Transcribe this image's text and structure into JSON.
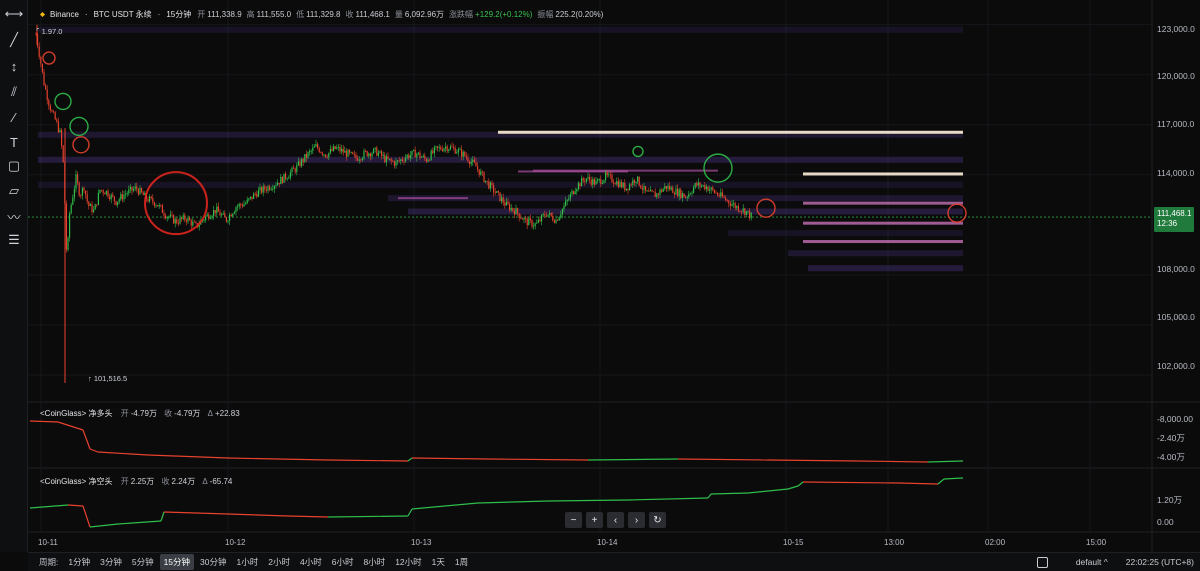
{
  "header": {
    "exchange": "Binance",
    "symbol": "BTC USDT 永续",
    "interval": "15分钟",
    "open_k": "开",
    "open_v": "111,338.9",
    "high_k": "高",
    "high_v": "111,555.0",
    "low_k": "低",
    "low_v": "111,329.8",
    "close_k": "收",
    "close_v": "111,468.1",
    "vol_k": "量",
    "vol_v": "6,092.96万",
    "chg_k": "涨跌幅",
    "chg_v": "+129.2(+0.12%)",
    "amp_k": "振幅",
    "amp_v": "225.2(0.20%)"
  },
  "price_scale": [
    "123,000.0",
    "120,000.0",
    "117,000.0",
    "114,000.0",
    "108,000.0",
    "105,000.0",
    "102,000.0"
  ],
  "price_tag": {
    "price": "111,468.1",
    "countdown": "12:36"
  },
  "high_marker": "1.97.0",
  "low_marker": "101,516.5",
  "indicator1": {
    "name": "<CoinGlass> 净多头",
    "open_k": "开",
    "open_v": "-4.79万",
    "close_k": "收",
    "close_v": "-4.79万",
    "delta_k": "Δ",
    "delta_v": "+22.83",
    "scale": [
      "-8,000.00",
      "-2.40万",
      "-4.00万"
    ]
  },
  "indicator2": {
    "name": "<CoinGlass> 净空头",
    "open_k": "开",
    "open_v": "2.25万",
    "close_k": "收",
    "close_v": "2.24万",
    "delta_k": "Δ",
    "delta_v": "-65.74",
    "scale": [
      "1.20万",
      "0.00"
    ]
  },
  "time_axis": [
    "10-11",
    "10-12",
    "10-13",
    "10-14",
    "10-15",
    "13:00",
    "02:00",
    "15:00"
  ],
  "nav_buttons": [
    "−",
    "+",
    "‹",
    "›",
    "↻"
  ],
  "bottom_bar": {
    "period_label": "周期:",
    "periods": [
      "1分钟",
      "3分钟",
      "5分钟",
      "15分钟",
      "30分钟",
      "1小时",
      "2小时",
      "4小时",
      "6小时",
      "8小时",
      "12小时",
      "1天",
      "1周"
    ],
    "active_period": "15分钟",
    "layout_name": "default",
    "layout_caret": "^",
    "clock": "22:02:25 (UTC+8)"
  },
  "colors": {
    "up": "#2fbf4a",
    "down": "#e8422e",
    "accent": "#1f7a3b",
    "liq_band": "#7a4fd6",
    "liq_line": "#f3e6d0"
  },
  "toolbar_icons": [
    "crosshair-line-icon",
    "trend-line-icon",
    "vertical-line-icon",
    "channel-icon",
    "ray-icon",
    "text-icon",
    "rectangle-icon",
    "parallelogram-icon",
    "path-icon",
    "fib-icon"
  ],
  "chart_data": {
    "type": "candlestick",
    "time_ticks": [
      "10-11",
      "10-12",
      "10-13",
      "10-14",
      "10-15",
      "13:00",
      "02:00",
      "15:00"
    ],
    "price_ticks": [
      123000,
      120000,
      117000,
      114000,
      108000,
      105000,
      102000
    ],
    "y_range": [
      100500,
      124000
    ],
    "last_price": 111468.1,
    "intraday_high": 122997.0,
    "intraday_low": 101516.5,
    "price_path": [
      [
        0,
        122400
      ],
      [
        4,
        121000
      ],
      [
        8,
        119500
      ],
      [
        12,
        118500
      ],
      [
        16,
        117700
      ],
      [
        20,
        117200
      ],
      [
        24,
        116500
      ],
      [
        27,
        115000
      ],
      [
        29,
        112000
      ],
      [
        31,
        108500
      ],
      [
        33,
        111500
      ],
      [
        36,
        112500
      ],
      [
        40,
        113800
      ],
      [
        44,
        112800
      ],
      [
        48,
        113300
      ],
      [
        52,
        112200
      ],
      [
        58,
        111800
      ],
      [
        64,
        113100
      ],
      [
        70,
        113000
      ],
      [
        80,
        112400
      ],
      [
        90,
        112900
      ],
      [
        100,
        113200
      ],
      [
        110,
        112600
      ],
      [
        120,
        112300
      ],
      [
        130,
        111600
      ],
      [
        140,
        111200
      ],
      [
        150,
        111400
      ],
      [
        160,
        110900
      ],
      [
        170,
        111500
      ],
      [
        180,
        111900
      ],
      [
        190,
        111300
      ],
      [
        200,
        112100
      ],
      [
        210,
        112300
      ],
      [
        220,
        112900
      ],
      [
        230,
        113200
      ],
      [
        240,
        113500
      ],
      [
        250,
        113900
      ],
      [
        260,
        114400
      ],
      [
        270,
        115100
      ],
      [
        280,
        115700
      ],
      [
        290,
        115200
      ],
      [
        300,
        115600
      ],
      [
        310,
        115300
      ],
      [
        320,
        115000
      ],
      [
        330,
        115300
      ],
      [
        340,
        115400
      ],
      [
        350,
        114900
      ],
      [
        360,
        114700
      ],
      [
        370,
        115100
      ],
      [
        380,
        115300
      ],
      [
        390,
        114900
      ],
      [
        400,
        115500
      ],
      [
        410,
        115700
      ],
      [
        420,
        115500
      ],
      [
        430,
        115100
      ],
      [
        440,
        114500
      ],
      [
        450,
        113600
      ],
      [
        460,
        112900
      ],
      [
        470,
        112200
      ],
      [
        480,
        111800
      ],
      [
        490,
        111200
      ],
      [
        500,
        111000
      ],
      [
        510,
        111700
      ],
      [
        520,
        111300
      ],
      [
        530,
        112300
      ],
      [
        540,
        113300
      ],
      [
        550,
        113800
      ],
      [
        560,
        113500
      ],
      [
        570,
        113900
      ],
      [
        580,
        113600
      ],
      [
        590,
        113200
      ],
      [
        600,
        113800
      ],
      [
        610,
        112900
      ],
      [
        620,
        112800
      ],
      [
        630,
        113300
      ],
      [
        640,
        113000
      ],
      [
        650,
        112700
      ],
      [
        660,
        113400
      ],
      [
        670,
        113300
      ],
      [
        680,
        112900
      ],
      [
        690,
        112500
      ],
      [
        700,
        112100
      ],
      [
        710,
        111800
      ],
      [
        716,
        111468
      ]
    ],
    "liquidation_lines": [
      {
        "price": 116550,
        "x": [
          470,
          935
        ]
      },
      {
        "price": 114050,
        "x": [
          775,
          935
        ]
      },
      {
        "price": 112300,
        "x": [
          775,
          935
        ]
      },
      {
        "price": 111100,
        "x": [
          775,
          935
        ]
      },
      {
        "price": 110000,
        "x": [
          775,
          935
        ]
      }
    ],
    "indicator_net_long": {
      "name": "<CoinGlass> 净多头",
      "open": "-4.79万",
      "close": "-4.79万",
      "delta": "+22.83"
    },
    "indicator_net_short": {
      "name": "<CoinGlass> 净空头",
      "open": "2.25万",
      "close": "2.24万",
      "delta": "-65.74"
    }
  }
}
